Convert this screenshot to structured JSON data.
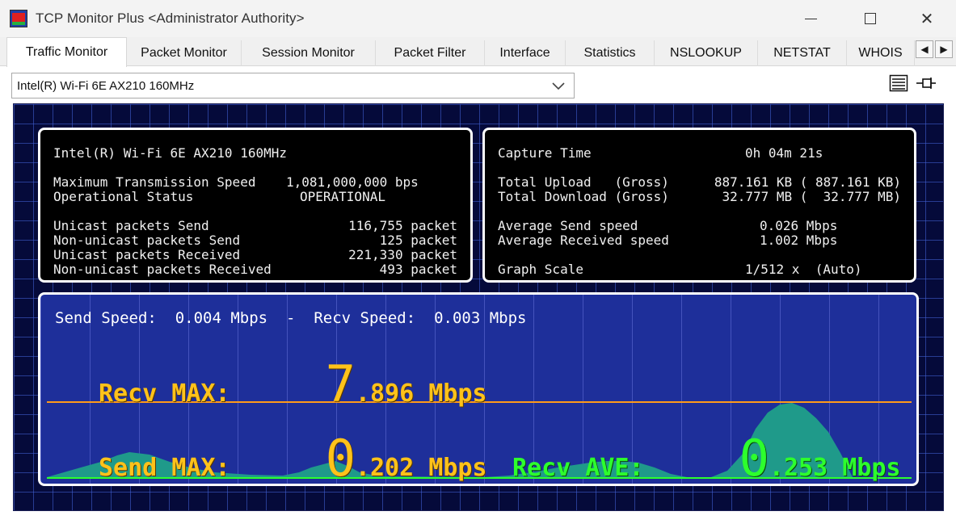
{
  "window": {
    "title": "TCP Monitor Plus <Administrator Authority>",
    "controls": {
      "minimize": "",
      "maximize": "",
      "close": "✕"
    }
  },
  "tabs": [
    {
      "label": "Traffic Monitor",
      "active": true
    },
    {
      "label": "Packet Monitor"
    },
    {
      "label": "Session Monitor"
    },
    {
      "label": "Packet Filter"
    },
    {
      "label": "Interface"
    },
    {
      "label": "Statistics"
    },
    {
      "label": "NSLOOKUP"
    },
    {
      "label": "NETSTAT"
    },
    {
      "label": "WHOIS"
    }
  ],
  "tab_scroll": {
    "left": "◀",
    "right": "▶"
  },
  "adapter_select": {
    "value": "Intel(R) Wi-Fi 6E AX210 160MHz"
  },
  "interface_panel": {
    "name": "Intel(R) Wi-Fi 6E AX210 160MHz",
    "rows": [
      {
        "label": "Maximum Transmission Speed",
        "value": "1,081,000,000 bps"
      },
      {
        "label": "Operational Status",
        "value": "OPERATIONAL"
      },
      {
        "label": "Unicast packets Send",
        "value": "116,755 packet"
      },
      {
        "label": "Non-unicast packets Send",
        "value": "125 packet"
      },
      {
        "label": "Unicast packets Received",
        "value": "221,330 packet"
      },
      {
        "label": "Non-unicast packets Received",
        "value": "493 packet"
      }
    ]
  },
  "capture_panel": {
    "rows": [
      {
        "label": "Capture Time",
        "value": "0h 04m 21s"
      },
      {
        "label": "Total Upload   (Gross)",
        "value": "887.161 KB ( 887.161 KB)"
      },
      {
        "label": "Total Download (Gross)",
        "value": "32.777 MB (  32.777 MB)"
      },
      {
        "label": "Average Send speed",
        "value": "0.026 Mbps"
      },
      {
        "label": "Average Received speed",
        "value": "1.002 Mbps"
      },
      {
        "label": "Graph Scale",
        "value": "1/512 x  (Auto)"
      }
    ]
  },
  "graph": {
    "send_speed_label": "Send Speed:",
    "send_speed_value": "0.004 Mbps",
    "separator": "-",
    "recv_speed_label": "Recv Speed:",
    "recv_speed_value": "0.003 Mbps",
    "recv_max": {
      "label": "Recv MAX:",
      "int": "7",
      "dec": ".896 Mbps"
    },
    "send_max": {
      "label": "Send MAX:",
      "int": "0",
      "dec": ".202 Mbps"
    },
    "recv_ave": {
      "label": "Recv AVE:",
      "int": "0",
      "dec": ".253 Mbps"
    },
    "colors": {
      "max_line": "#ff9a1a",
      "fill": "#1f9a8a",
      "baseline": "#2dff2d"
    }
  }
}
